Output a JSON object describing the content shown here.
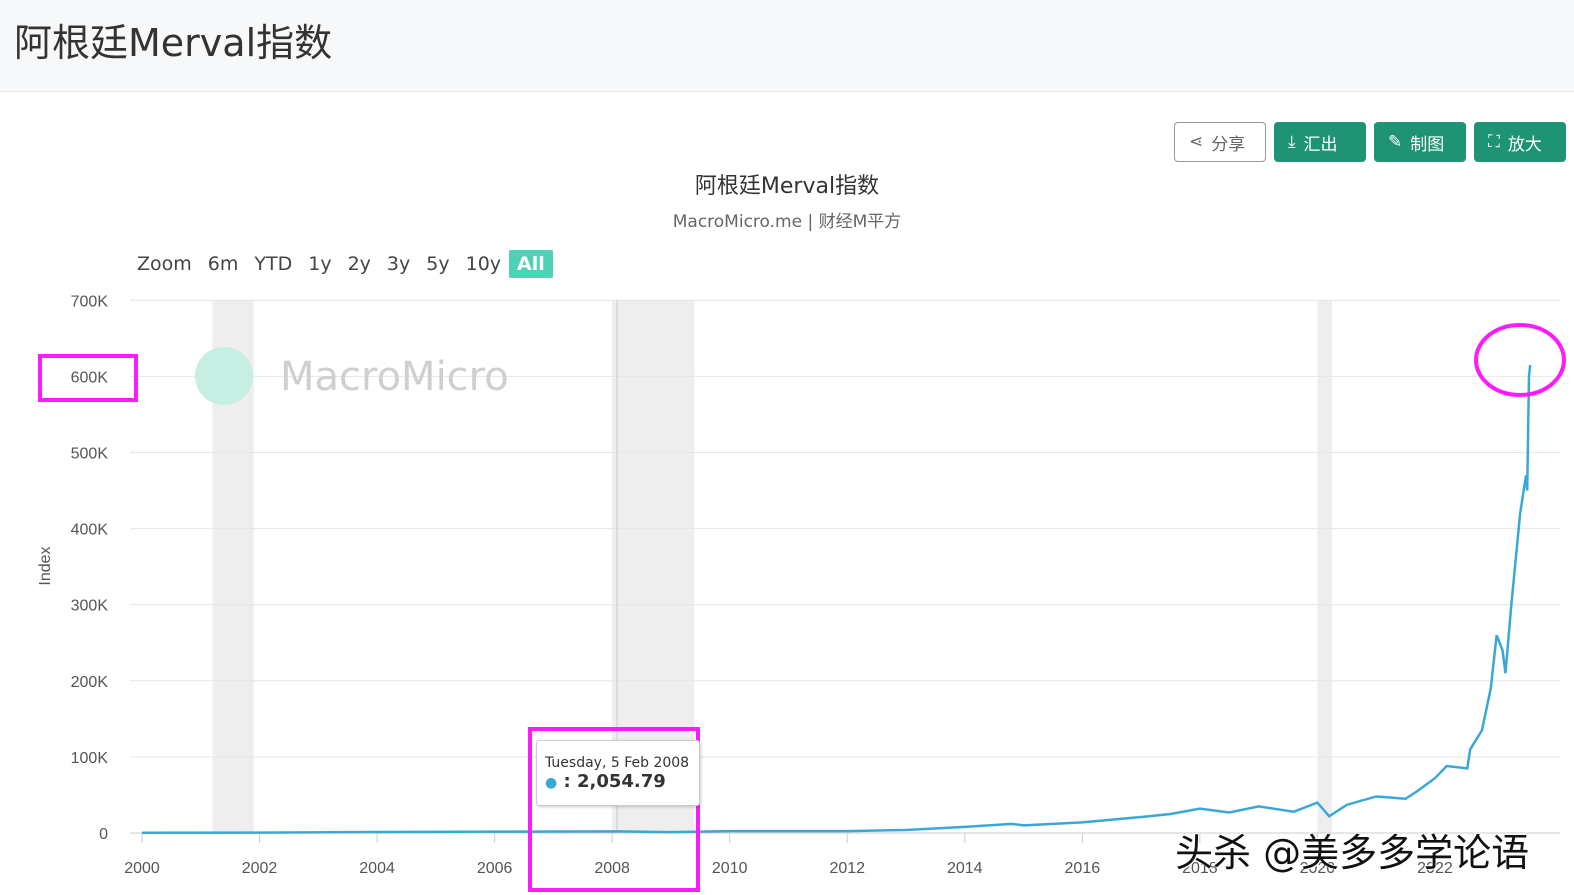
{
  "header": {
    "title": "阿根廷Merval指数"
  },
  "toolbar": {
    "share": "分享",
    "export": "汇出",
    "draw": "制图",
    "enlarge": "放大"
  },
  "range_selector": {
    "label": "Zoom",
    "options": [
      "6m",
      "YTD",
      "1y",
      "2y",
      "3y",
      "5y",
      "10y",
      "All"
    ],
    "active": "All"
  },
  "tooltip": {
    "date": "Tuesday, 5 Feb 2008",
    "value": "2,054.79",
    "bullet": "●"
  },
  "watermark": {
    "text": "头杀 @美多多学论语",
    "logo": "MacroMicro"
  },
  "colors": {
    "line": "#3aa8d6",
    "accent": "#1f9474",
    "highlight": "#ff1aff"
  },
  "chart_data": {
    "type": "line",
    "title": "阿根廷Merval指数",
    "subtitle": "MacroMicro.me | 财经M平方",
    "xlabel": "",
    "ylabel": "Index",
    "xlim": [
      2000,
      2024
    ],
    "ylim": [
      0,
      700000
    ],
    "x_ticks": [
      "2000",
      "2002",
      "2004",
      "2006",
      "2008",
      "2010",
      "2012",
      "2014",
      "2016",
      "2018",
      "2020",
      "2022"
    ],
    "y_ticks": [
      "0",
      "100K",
      "200K",
      "300K",
      "400K",
      "500K",
      "600K",
      "700K"
    ],
    "grid": true,
    "recession_bands": [
      [
        2001.2,
        2001.9
      ],
      [
        2008.0,
        2009.4
      ],
      [
        2020.0,
        2020.25
      ]
    ],
    "series": [
      {
        "name": "Merval",
        "x": [
          2000,
          2002,
          2004,
          2006,
          2008.1,
          2009,
          2010,
          2012,
          2013,
          2014,
          2014.8,
          2015,
          2016,
          2017,
          2017.5,
          2018,
          2018.5,
          2019,
          2019.6,
          2020,
          2020.2,
          2020.5,
          2021,
          2021.5,
          2021.7,
          2022,
          2022.2,
          2022.55,
          2022.6,
          2022.8,
          2022.95,
          2023.05,
          2023.15,
          2023.2,
          2023.3,
          2023.45,
          2023.55,
          2023.57,
          2023.6,
          2023.62
        ],
        "values": [
          400,
          500,
          1300,
          1800,
          2055,
          1200,
          2500,
          2500,
          4000,
          8000,
          12000,
          10000,
          14000,
          21000,
          25000,
          32000,
          27000,
          35000,
          28000,
          40000,
          22000,
          37000,
          48000,
          45000,
          55000,
          72000,
          88000,
          85000,
          110000,
          135000,
          190000,
          260000,
          240000,
          210000,
          300000,
          420000,
          470000,
          450000,
          600000,
          615000
        ]
      }
    ]
  }
}
